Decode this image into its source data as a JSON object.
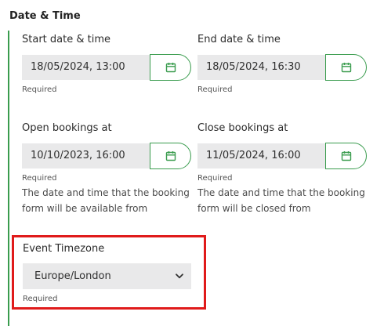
{
  "section": {
    "title": "Date & Time"
  },
  "start": {
    "label": "Start date & time",
    "value": "18/05/2024, 13:00",
    "hint": "Required"
  },
  "end": {
    "label": "End date & time",
    "value": "18/05/2024, 16:30",
    "hint": "Required"
  },
  "open_bookings": {
    "label": "Open bookings at",
    "value": "10/10/2023, 16:00",
    "hint": "Required",
    "description": "The date and time that the booking form will be available from"
  },
  "close_bookings": {
    "label": "Close bookings at",
    "value": "11/05/2024, 16:00",
    "hint": "Required",
    "description": "The date and time that the booking form will be closed from"
  },
  "timezone": {
    "label": "Event Timezone",
    "selected": "Europe/London",
    "hint": "Required"
  },
  "icons": {
    "calendar": "calendar-icon",
    "chevron": "chevron-down-icon"
  },
  "colors": {
    "accent_green": "#3a9c4e",
    "highlight_red": "#e01b1b",
    "field_background": "#e9e9ea"
  }
}
